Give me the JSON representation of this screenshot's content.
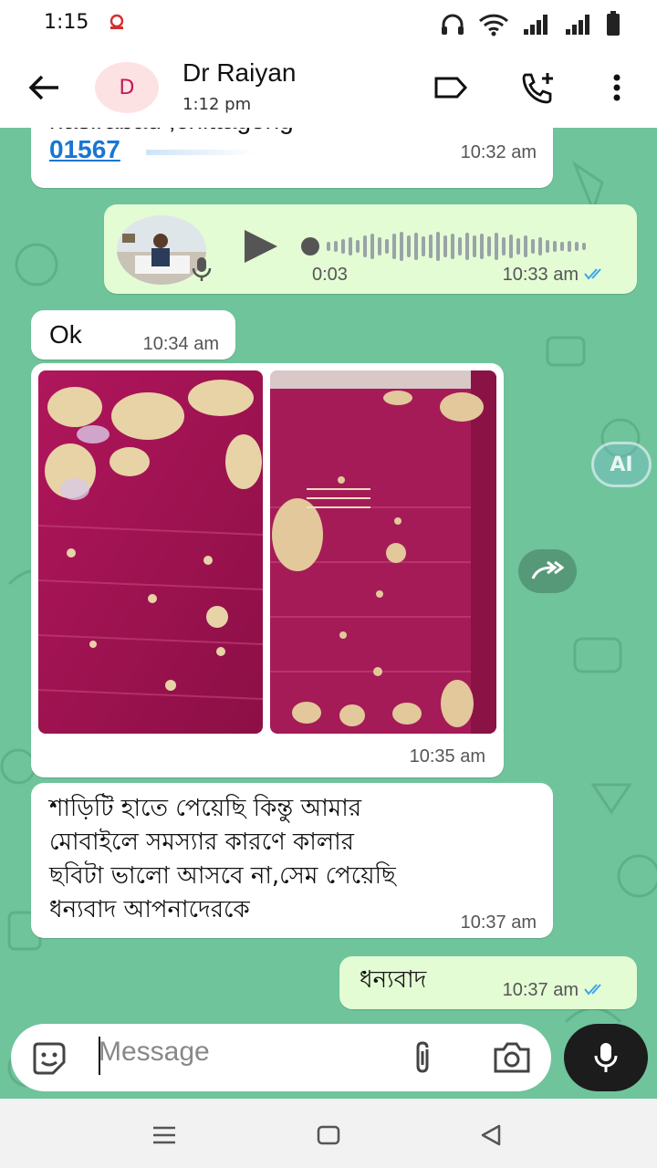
{
  "status": {
    "time": "1:15"
  },
  "header": {
    "avatar_letter": "D",
    "name": "Dr Raiyan",
    "subtitle": "1:12 pm"
  },
  "messages": {
    "m1": {
      "line1": "nasirabad ,chittagong",
      "phone": "01567",
      "time": "10:32 am"
    },
    "m2": {
      "duration": "0:03",
      "time": "10:33 am"
    },
    "m3": {
      "text": "Ok",
      "time": "10:34 am"
    },
    "m4": {
      "time": "10:35 am"
    },
    "m5": {
      "line1": "শাড়িটি  হাতে পেয়েছি কিন্তু আমার",
      "line2": "মোবাইলে সমস্যার কারণে কালার",
      "line3": "ছবিটা ভালো আসবে না,সেম পেয়েছি",
      "line4": "ধন্যবাদ আপনাদেরকে",
      "time": "10:37 am"
    },
    "m6": {
      "text": "ধন্যবাদ",
      "time": "10:37 am"
    }
  },
  "ai_badge": "AI",
  "composer": {
    "placeholder": "Message"
  },
  "colors": {
    "chat_bg": "#6fc49b",
    "outgoing": "#e3fcd4",
    "incoming": "#ffffff",
    "tick": "#3da4e8",
    "saree": "#a3124f"
  }
}
